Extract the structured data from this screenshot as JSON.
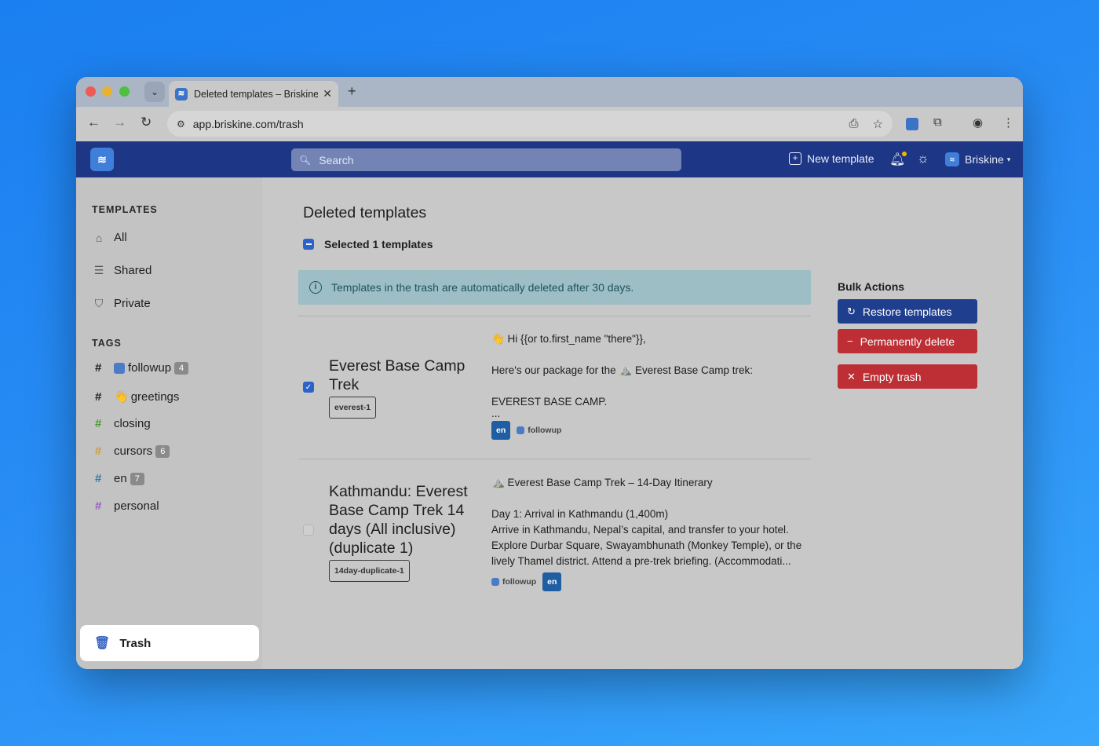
{
  "browser": {
    "tab_title": "Deleted templates – Briskine",
    "url": "app.briskine.com/trash",
    "tab_menu_icon": "chevron-down-icon",
    "new_tab_icon": "plus-icon"
  },
  "header": {
    "logo_icon": "briskine-logo-icon",
    "search_placeholder": "Search",
    "new_template_label": "New template",
    "user_label": "Briskine",
    "colors": {
      "header_bg": "#1d3685",
      "accent": "#2d62c8"
    }
  },
  "sidebar": {
    "templates_title": "TEMPLATES",
    "templates": [
      {
        "label": "All",
        "icon": "inbox-icon"
      },
      {
        "label": "Shared",
        "icon": "shared-inbox-icon"
      },
      {
        "label": "Private",
        "icon": "shield-icon"
      }
    ],
    "tags_title": "TAGS",
    "tags": [
      {
        "label": "followup",
        "count": "4",
        "hash_color": "#1e1e1e",
        "emoji": "followup-emoji-icon"
      },
      {
        "label": "greetings",
        "count": "",
        "hash_color": "#1e1e1e",
        "emoji": "👋"
      },
      {
        "label": "closing",
        "count": "",
        "hash_color": "#4a9a3a"
      },
      {
        "label": "cursors",
        "count": "6",
        "hash_color": "#d99a2b"
      },
      {
        "label": "en",
        "count": "7",
        "hash_color": "#2a7ea0"
      },
      {
        "label": "personal",
        "count": "",
        "hash_color": "#9b5cc0"
      }
    ],
    "trash_label": "Trash"
  },
  "main": {
    "title": "Deleted templates",
    "selected_text": "Selected 1 templates",
    "info_text": "Templates in the trash are automatically deleted after 30 days.",
    "rows": [
      {
        "title": "Everest Base Camp Trek",
        "shortcut": "everest-1",
        "checked": true,
        "body": [
          "👋 Hi {{or to.first_name \"there\"}},",
          "",
          "Here's our package for the ⛰️ Everest Base Camp trek:",
          "",
          "EVEREST BASE CAMP.",
          "..."
        ],
        "chips": [
          {
            "type": "lang",
            "label": "en"
          },
          {
            "type": "tag",
            "label": "followup"
          }
        ]
      },
      {
        "title": "Kathmandu: Everest Base Camp Trek 14 days (All inclusive) (duplicate 1)",
        "shortcut": "14day-duplicate-1",
        "checked": false,
        "body": [
          "⛰️ Everest Base Camp Trek – 14-Day Itinerary",
          "",
          "Day 1: Arrival in Kathmandu (1,400m)",
          "Arrive in Kathmandu, Nepal’s capital, and transfer to your hotel.",
          "Explore Durbar Square, Swayambhunath (Monkey Temple), or the",
          "lively Thamel district. Attend a pre-trek briefing. (Accommodati..."
        ],
        "chips": [
          {
            "type": "tag",
            "label": "followup"
          },
          {
            "type": "lang",
            "label": "en"
          }
        ]
      }
    ]
  },
  "bulk": {
    "title": "Bulk Actions",
    "restore_label": "Restore templates",
    "delete_label": "Permanently delete",
    "empty_label": "Empty trash"
  }
}
